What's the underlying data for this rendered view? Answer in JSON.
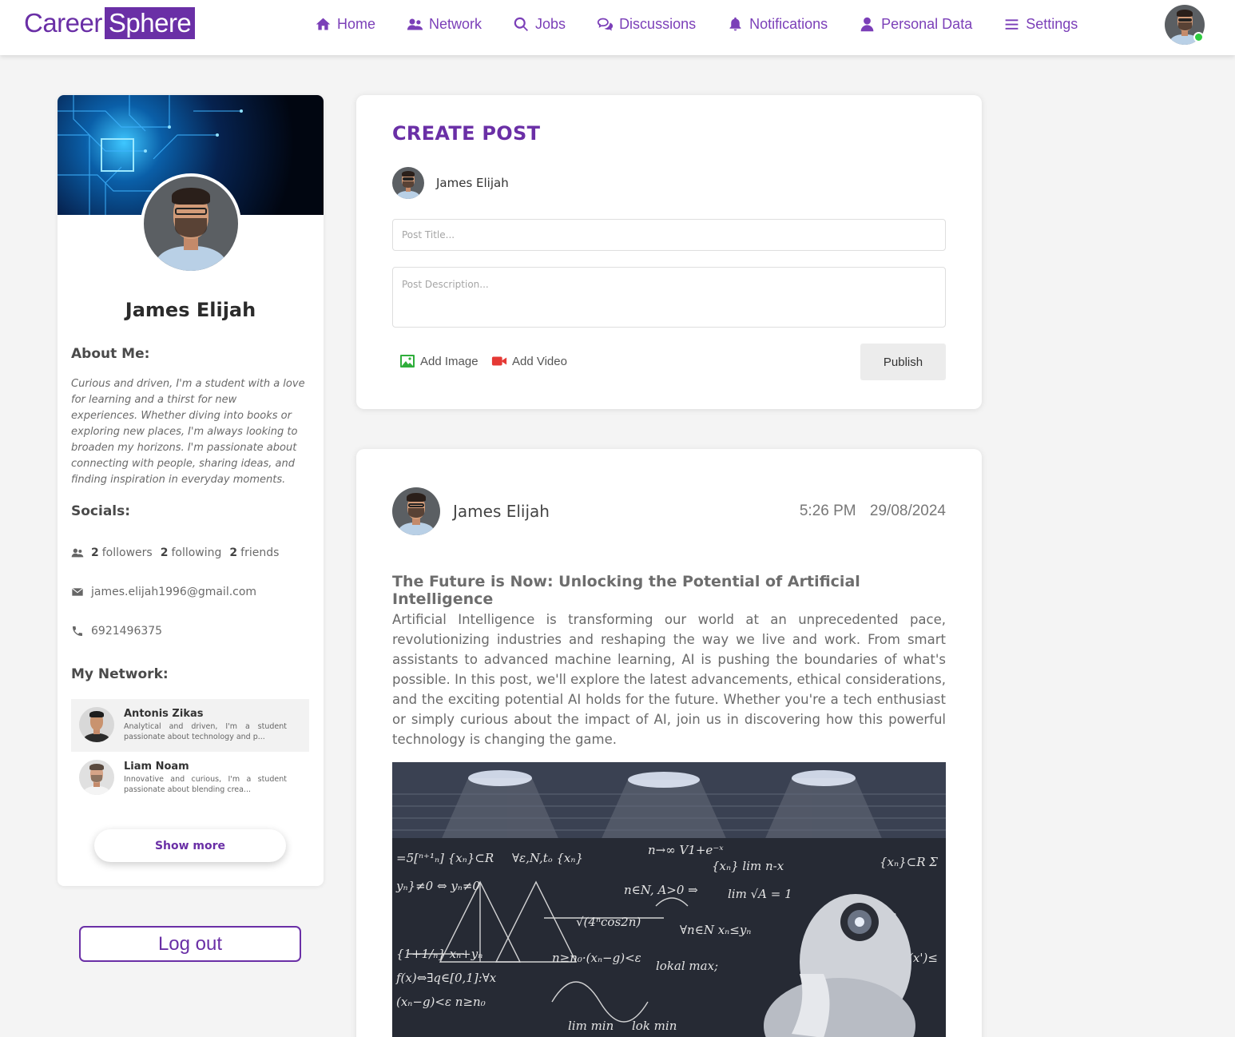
{
  "brand": {
    "part1": "Career",
    "part2": "Sphere"
  },
  "nav": [
    {
      "label": "Home",
      "icon": "home-icon"
    },
    {
      "label": "Network",
      "icon": "users-icon"
    },
    {
      "label": "Jobs",
      "icon": "search-icon"
    },
    {
      "label": "Discussions",
      "icon": "chat-icon"
    },
    {
      "label": "Notifications",
      "icon": "bell-icon"
    },
    {
      "label": "Personal Data",
      "icon": "user-icon"
    },
    {
      "label": "Settings",
      "icon": "menu-icon"
    }
  ],
  "colors": {
    "accent": "#6a2fa6",
    "online": "#2ecc40"
  },
  "profile": {
    "name": "James Elijah",
    "about_heading": "About Me:",
    "about": "Curious and driven, I'm a student with a love for learning and a thirst for new experiences. Whether diving into books or exploring new places, I'm always looking to broaden my horizons. I'm passionate about connecting with people, sharing ideas, and finding inspiration in everyday moments.",
    "socials_heading": "Socials:",
    "followers_count": "2",
    "followers_label": "followers",
    "following_count": "2",
    "following_label": "following",
    "friends_count": "2",
    "friends_label": "friends",
    "email": "james.elijah1996@gmail.com",
    "phone": "6921496375",
    "network_heading": "My Network:",
    "network": [
      {
        "name": "Antonis Zikas",
        "desc": "Analytical and driven, I'm a student passionate about technology and p..."
      },
      {
        "name": "Liam Noam",
        "desc": "Innovative and curious, I'm a student passionate about blending crea..."
      }
    ],
    "show_more": "Show more",
    "logout": "Log out"
  },
  "create_post": {
    "heading": "CREATE POST",
    "user": "James Elijah",
    "title_placeholder": "Post Title...",
    "desc_placeholder": "Post Description...",
    "add_image": "Add Image",
    "add_video": "Add Video",
    "publish": "Publish"
  },
  "post": {
    "author": "James Elijah",
    "time": "5:26 PM",
    "date": "29/08/2024",
    "title": "The Future is Now: Unlocking the Potential of Artificial Intelligence",
    "body": "Artificial Intelligence is transforming our world at an unprecedented pace, revolutionizing industries and reshaping the way we live and work. From smart assistants to advanced machine learning, AI is pushing the boundaries of what's possible. In this post, we'll explore the latest advancements, ethical considerations, and the exciting potential AI holds for the future. Whether you're a tech enthusiast or simply curious about the impact of AI, join us in discovering how this powerful technology is changing the game."
  }
}
